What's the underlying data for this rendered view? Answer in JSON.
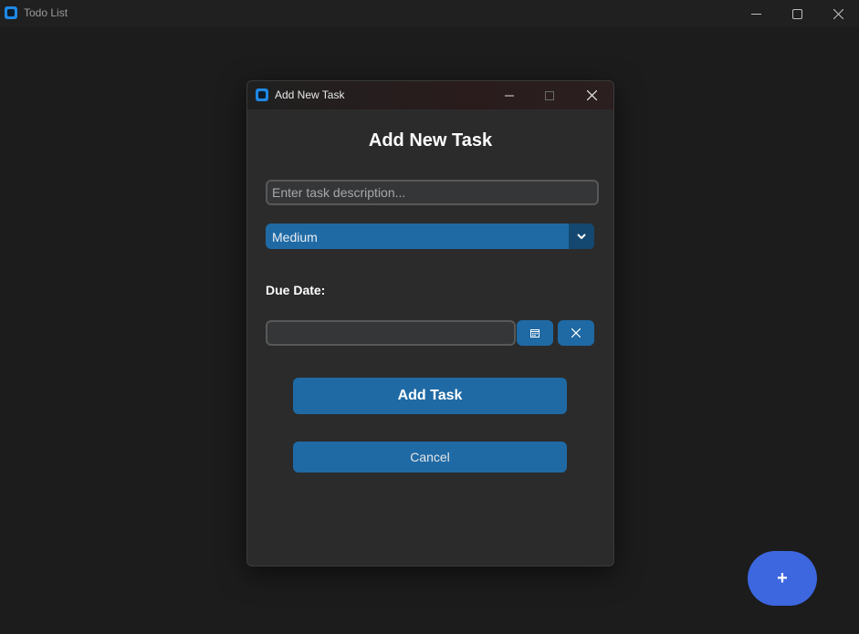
{
  "main_window": {
    "title": "Todo List"
  },
  "dialog": {
    "title": "Add New Task",
    "heading": "Add New Task",
    "task_input": {
      "value": "",
      "placeholder": "Enter task description..."
    },
    "priority": {
      "selected": "Medium"
    },
    "due_date_label": "Due Date:",
    "due_date_input": {
      "value": ""
    },
    "add_button": "Add Task",
    "cancel_button": "Cancel"
  },
  "fab": {
    "label": "+"
  },
  "colors": {
    "accent": "#1f6aa5",
    "accent_dark": "#144870",
    "fab": "#3d67df",
    "background": "#1c1c1c",
    "dialog_bg": "#2b2b2b"
  },
  "icons": {
    "app": "app-icon",
    "calendar": "calendar-icon",
    "clear": "close-icon",
    "dropdown": "chevron-down-icon"
  }
}
